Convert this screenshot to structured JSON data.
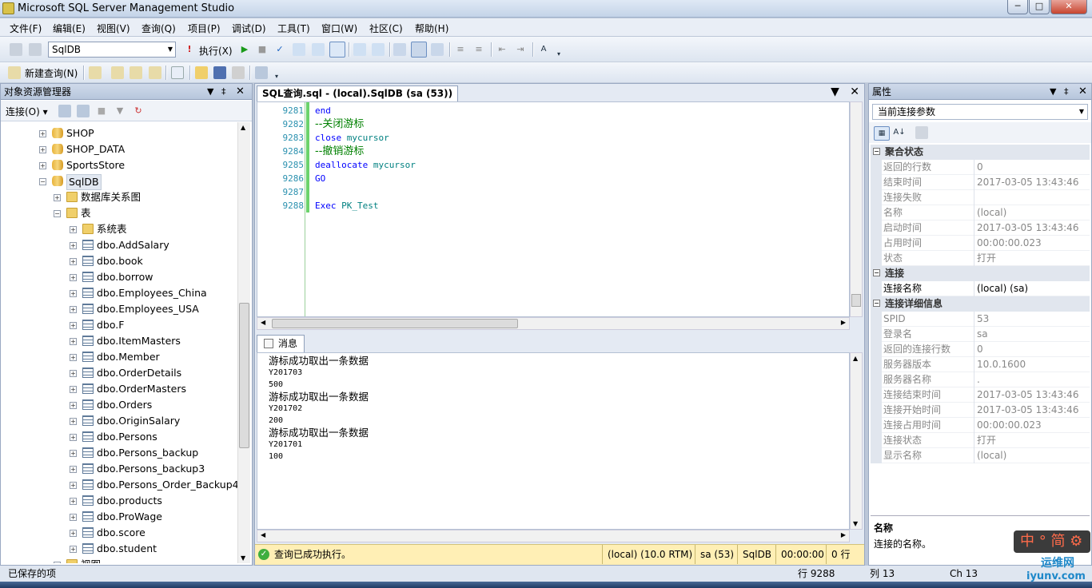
{
  "window": {
    "title": "Microsoft SQL Server Management Studio",
    "min": "─",
    "max": "□",
    "close": "✕"
  },
  "menu": [
    "文件(F)",
    "编辑(E)",
    "视图(V)",
    "查询(Q)",
    "项目(P)",
    "调试(D)",
    "工具(T)",
    "窗口(W)",
    "社区(C)",
    "帮助(H)"
  ],
  "toolbar": {
    "database": "SqlDB",
    "execute": "执行(X)",
    "new_query": "新建查询(N)"
  },
  "object_explorer": {
    "title": "对象资源管理器",
    "connect": "连接(O)",
    "nodes": [
      {
        "label": "SHOP",
        "type": "db",
        "level": 0,
        "exp": "+"
      },
      {
        "label": "SHOP_DATA",
        "type": "db",
        "level": 0,
        "exp": "+"
      },
      {
        "label": "SportsStore",
        "type": "db",
        "level": 0,
        "exp": "+"
      },
      {
        "label": "SqlDB",
        "type": "db",
        "level": 0,
        "exp": "−",
        "selected": true
      },
      {
        "label": "数据库关系图",
        "type": "folder",
        "level": 1,
        "exp": "+"
      },
      {
        "label": "表",
        "type": "folder",
        "level": 1,
        "exp": "−"
      },
      {
        "label": "系统表",
        "type": "folder",
        "level": 2,
        "exp": "+"
      },
      {
        "label": "dbo.AddSalary",
        "type": "table",
        "level": 2,
        "exp": "+"
      },
      {
        "label": "dbo.book",
        "type": "table",
        "level": 2,
        "exp": "+"
      },
      {
        "label": "dbo.borrow",
        "type": "table",
        "level": 2,
        "exp": "+"
      },
      {
        "label": "dbo.Employees_China",
        "type": "table",
        "level": 2,
        "exp": "+"
      },
      {
        "label": "dbo.Employees_USA",
        "type": "table",
        "level": 2,
        "exp": "+"
      },
      {
        "label": "dbo.F",
        "type": "table",
        "level": 2,
        "exp": "+"
      },
      {
        "label": "dbo.ItemMasters",
        "type": "table",
        "level": 2,
        "exp": "+"
      },
      {
        "label": "dbo.Member",
        "type": "table",
        "level": 2,
        "exp": "+"
      },
      {
        "label": "dbo.OrderDetails",
        "type": "table",
        "level": 2,
        "exp": "+"
      },
      {
        "label": "dbo.OrderMasters",
        "type": "table",
        "level": 2,
        "exp": "+"
      },
      {
        "label": "dbo.Orders",
        "type": "table",
        "level": 2,
        "exp": "+"
      },
      {
        "label": "dbo.OriginSalary",
        "type": "table",
        "level": 2,
        "exp": "+"
      },
      {
        "label": "dbo.Persons",
        "type": "table",
        "level": 2,
        "exp": "+"
      },
      {
        "label": "dbo.Persons_backup",
        "type": "table",
        "level": 2,
        "exp": "+"
      },
      {
        "label": "dbo.Persons_backup3",
        "type": "table",
        "level": 2,
        "exp": "+"
      },
      {
        "label": "dbo.Persons_Order_Backup4",
        "type": "table",
        "level": 2,
        "exp": "+"
      },
      {
        "label": "dbo.products",
        "type": "table",
        "level": 2,
        "exp": "+"
      },
      {
        "label": "dbo.ProWage",
        "type": "table",
        "level": 2,
        "exp": "+"
      },
      {
        "label": "dbo.score",
        "type": "table",
        "level": 2,
        "exp": "+"
      },
      {
        "label": "dbo.student",
        "type": "table",
        "level": 2,
        "exp": "+"
      },
      {
        "label": "视图",
        "type": "folder",
        "level": 1,
        "exp": "+"
      }
    ]
  },
  "editor": {
    "tab": "SQL查询.sql - (local).SqlDB (sa (53))",
    "lines": [
      {
        "no": "9281",
        "parts": [
          {
            "t": "end",
            "c": "kw"
          }
        ]
      },
      {
        "no": "9282",
        "parts": [
          {
            "t": "--关闭游标",
            "c": "cm"
          }
        ]
      },
      {
        "no": "9283",
        "parts": [
          {
            "t": "close ",
            "c": "kw"
          },
          {
            "t": "mycursor",
            "c": "id"
          }
        ]
      },
      {
        "no": "9284",
        "parts": [
          {
            "t": "--撤销游标",
            "c": "cm"
          }
        ]
      },
      {
        "no": "9285",
        "parts": [
          {
            "t": "deallocate ",
            "c": "kw"
          },
          {
            "t": "mycursor",
            "c": "id"
          }
        ]
      },
      {
        "no": "9286",
        "parts": [
          {
            "t": "GO",
            "c": "kw"
          }
        ]
      },
      {
        "no": "9287",
        "parts": []
      },
      {
        "no": "9288",
        "parts": [
          {
            "t": "Exec ",
            "c": "kw"
          },
          {
            "t": "PK_Test",
            "c": "id"
          }
        ]
      }
    ]
  },
  "messages": {
    "tab": "消息",
    "lines": [
      {
        "t": "游标成功取出一条数据",
        "small": false
      },
      {
        "t": "Y201703",
        "small": true
      },
      {
        "t": "500",
        "small": true
      },
      {
        "t": "游标成功取出一条数据",
        "small": false
      },
      {
        "t": "Y201702",
        "small": true
      },
      {
        "t": "200",
        "small": true
      },
      {
        "t": "游标成功取出一条数据",
        "small": false
      },
      {
        "t": "Y201701",
        "small": true
      },
      {
        "t": "100",
        "small": true
      }
    ]
  },
  "query_status": {
    "message": "查询已成功执行。",
    "server": "(local) (10.0 RTM)",
    "user": "sa (53)",
    "db": "SqlDB",
    "time": "00:00:00",
    "rows": "0 行",
    "color": "#ffefb5"
  },
  "properties": {
    "title": "属性",
    "object": "当前连接参数",
    "groups": [
      {
        "name": "聚合状态",
        "rows": [
          {
            "k": "返回的行数",
            "v": "0"
          },
          {
            "k": "结束时间",
            "v": "2017-03-05 13:43:46"
          },
          {
            "k": "连接失败",
            "v": ""
          },
          {
            "k": "名称",
            "v": "(local)"
          },
          {
            "k": "启动时间",
            "v": "2017-03-05 13:43:46"
          },
          {
            "k": "占用时间",
            "v": "00:00:00.023"
          },
          {
            "k": "状态",
            "v": "打开"
          }
        ]
      },
      {
        "name": "连接",
        "rows": [
          {
            "k": "连接名称",
            "v": "(local) (sa)",
            "dark": true
          }
        ]
      },
      {
        "name": "连接详细信息",
        "rows": [
          {
            "k": "SPID",
            "v": "53"
          },
          {
            "k": "登录名",
            "v": "sa"
          },
          {
            "k": "返回的连接行数",
            "v": "0"
          },
          {
            "k": "服务器版本",
            "v": "10.0.1600"
          },
          {
            "k": "服务器名称",
            "v": "."
          },
          {
            "k": "连接结束时间",
            "v": "2017-03-05 13:43:46"
          },
          {
            "k": "连接开始时间",
            "v": "2017-03-05 13:43:46"
          },
          {
            "k": "连接占用时间",
            "v": "00:00:00.023"
          },
          {
            "k": "连接状态",
            "v": "打开"
          },
          {
            "k": "显示名称",
            "v": "(local)"
          }
        ]
      }
    ],
    "desc_title": "名称",
    "desc_text": "连接的名称。"
  },
  "statusbar": {
    "left": "已保存的项",
    "line": "行 9288",
    "col": "列 13",
    "ch": "Ch 13"
  },
  "ime": "中 ° 简 ⚙",
  "watermark": {
    "top": "运维网",
    "bottom": "iyunv.com"
  }
}
